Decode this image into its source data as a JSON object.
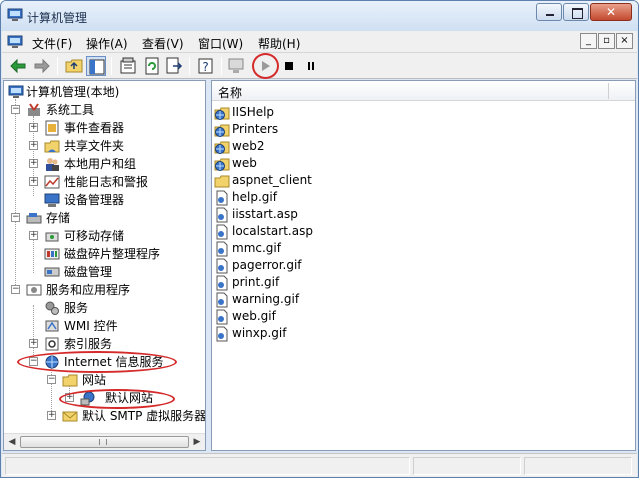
{
  "window": {
    "title": "计算机管理"
  },
  "menu": {
    "items": [
      {
        "label": "文件(F)"
      },
      {
        "label": "操作(A)"
      },
      {
        "label": "查看(V)"
      },
      {
        "label": "窗口(W)"
      },
      {
        "label": "帮助(H)"
      }
    ]
  },
  "mdi": {
    "min": "_",
    "restore": "▫",
    "close": "×"
  },
  "tree": {
    "root": "计算机管理(本地)",
    "items": [
      {
        "label": "系统工具",
        "icon": "tools-icon"
      },
      {
        "label": "事件查看器",
        "icon": "event-viewer-icon"
      },
      {
        "label": "共享文件夹",
        "icon": "shared-folder-icon"
      },
      {
        "label": "本地用户和组",
        "icon": "users-icon"
      },
      {
        "label": "性能日志和警报",
        "icon": "performance-icon"
      },
      {
        "label": "设备管理器",
        "icon": "device-manager-icon"
      },
      {
        "label": "存储",
        "icon": "storage-icon"
      },
      {
        "label": "可移动存储",
        "icon": "removable-storage-icon"
      },
      {
        "label": "磁盘碎片整理程序",
        "icon": "defrag-icon"
      },
      {
        "label": "磁盘管理",
        "icon": "disk-management-icon"
      },
      {
        "label": "服务和应用程序",
        "icon": "services-apps-icon"
      },
      {
        "label": "服务",
        "icon": "services-icon"
      },
      {
        "label": "WMI 控件",
        "icon": "wmi-icon"
      },
      {
        "label": "索引服务",
        "icon": "indexing-icon"
      },
      {
        "label": "Internet 信息服务",
        "icon": "iis-icon"
      },
      {
        "label": "网站",
        "icon": "folder-icon"
      },
      {
        "label": "默认网站",
        "icon": "website-icon"
      },
      {
        "label": "默认 SMTP 虚拟服务器",
        "icon": "smtp-icon"
      }
    ]
  },
  "list": {
    "column": "名称",
    "items": [
      {
        "name": "IISHelp",
        "icon": "web-folder-icon"
      },
      {
        "name": "Printers",
        "icon": "web-folder-icon"
      },
      {
        "name": "web2",
        "icon": "web-folder-icon"
      },
      {
        "name": "web",
        "icon": "web-folder-icon"
      },
      {
        "name": "aspnet_client",
        "icon": "folder-icon"
      },
      {
        "name": "help.gif",
        "icon": "file-icon"
      },
      {
        "name": "iisstart.asp",
        "icon": "file-icon"
      },
      {
        "name": "localstart.asp",
        "icon": "file-icon"
      },
      {
        "name": "mmc.gif",
        "icon": "file-icon"
      },
      {
        "name": "pagerror.gif",
        "icon": "file-icon"
      },
      {
        "name": "print.gif",
        "icon": "file-icon"
      },
      {
        "name": "warning.gif",
        "icon": "file-icon"
      },
      {
        "name": "web.gif",
        "icon": "file-icon"
      },
      {
        "name": "winxp.gif",
        "icon": "file-icon"
      }
    ]
  },
  "scroll": {
    "left": "◀",
    "right": "▶"
  },
  "tree_expanders": {
    "plus": "+",
    "minus": "−"
  },
  "colors": {
    "accent": "#316ac5",
    "annotation": "#d52a2a"
  }
}
